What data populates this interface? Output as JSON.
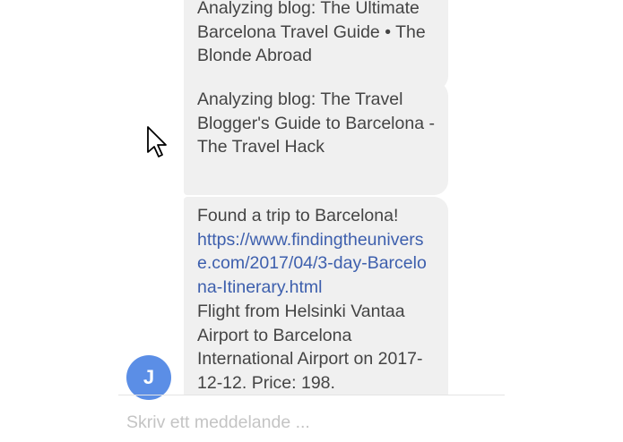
{
  "messages": [
    {
      "text": "Analyzing blog: The Ultimate Barcelona Travel Guide • The Blonde Abroad"
    },
    {
      "text": "Analyzing blog: The Travel Blogger's Guide to Barcelona - The Travel Hack"
    },
    {
      "intro": "Found a trip to Barcelona!",
      "link": "https://www.findingtheuniverse.com/2017/04/3-day-Barcelona-Itinerary.html",
      "details": "Flight from Helsinki Vantaa Airport to Barcelona International Airport on 2017-12-12. Price: 198."
    }
  ],
  "avatar": {
    "initial": "J",
    "color": "#5b8ee6"
  },
  "composer": {
    "placeholder": "Skriv ett meddelande ..."
  },
  "colors": {
    "bubble": "#f0f0f0",
    "link": "#3d5fad",
    "text": "#444444"
  }
}
